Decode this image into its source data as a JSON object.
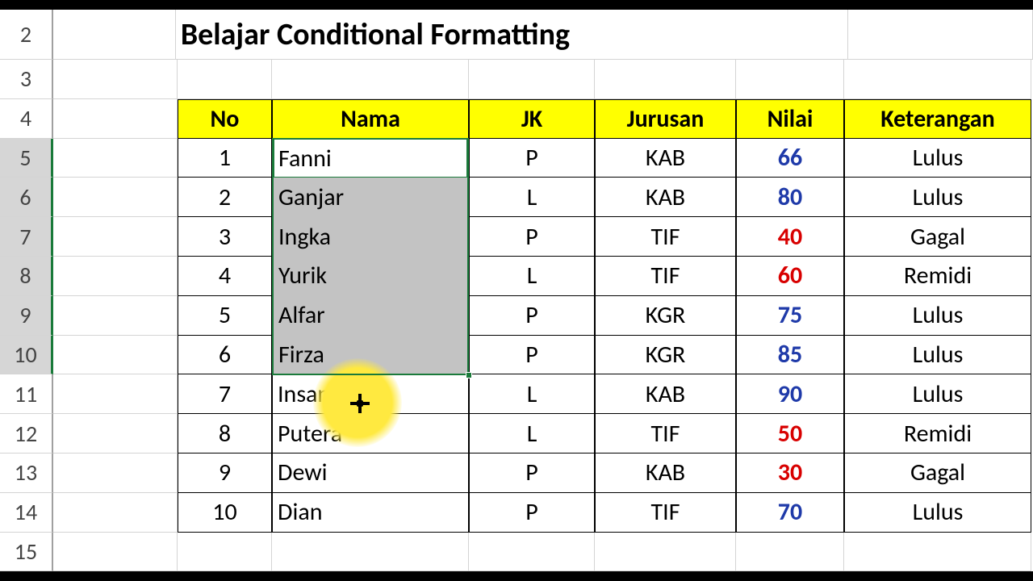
{
  "title": "Belajar Conditional Formatting",
  "row_numbers": [
    2,
    3,
    4,
    5,
    6,
    7,
    8,
    9,
    10,
    11,
    12,
    13,
    14,
    15
  ],
  "headers": {
    "no": "No",
    "nama": "Nama",
    "jk": "JK",
    "jurusan": "Jurusan",
    "nilai": "Nilai",
    "keterangan": "Keterangan"
  },
  "rows": [
    {
      "no": 1,
      "nama": "Fanni",
      "jk": "P",
      "jurusan": "KAB",
      "nilai": 66,
      "nilai_color": "blue",
      "keterangan": "Lulus"
    },
    {
      "no": 2,
      "nama": "Ganjar",
      "jk": "L",
      "jurusan": "KAB",
      "nilai": 80,
      "nilai_color": "blue",
      "keterangan": "Lulus"
    },
    {
      "no": 3,
      "nama": "Ingka",
      "jk": "P",
      "jurusan": "TIF",
      "nilai": 40,
      "nilai_color": "red",
      "keterangan": "Gagal"
    },
    {
      "no": 4,
      "nama": "Yurik",
      "jk": "L",
      "jurusan": "TIF",
      "nilai": 60,
      "nilai_color": "red",
      "keterangan": "Remidi"
    },
    {
      "no": 5,
      "nama": "Alfar",
      "jk": "P",
      "jurusan": "KGR",
      "nilai": 75,
      "nilai_color": "blue",
      "keterangan": "Lulus"
    },
    {
      "no": 6,
      "nama": "Firza",
      "jk": "P",
      "jurusan": "KGR",
      "nilai": 85,
      "nilai_color": "blue",
      "keterangan": "Lulus"
    },
    {
      "no": 7,
      "nama": "Insan",
      "jk": "L",
      "jurusan": "KAB",
      "nilai": 90,
      "nilai_color": "blue",
      "keterangan": "Lulus"
    },
    {
      "no": 8,
      "nama": "Putera",
      "jk": "L",
      "jurusan": "TIF",
      "nilai": 50,
      "nilai_color": "red",
      "keterangan": "Remidi"
    },
    {
      "no": 9,
      "nama": "Dewi",
      "jk": "P",
      "jurusan": "KAB",
      "nilai": 30,
      "nilai_color": "red",
      "keterangan": "Gagal"
    },
    {
      "no": 10,
      "nama": "Dian",
      "jk": "P",
      "jurusan": "TIF",
      "nilai": 70,
      "nilai_color": "blue",
      "keterangan": "Lulus"
    }
  ],
  "selection": {
    "from_row": 5,
    "to_row": 10,
    "col": "nama",
    "active_row": 5
  }
}
